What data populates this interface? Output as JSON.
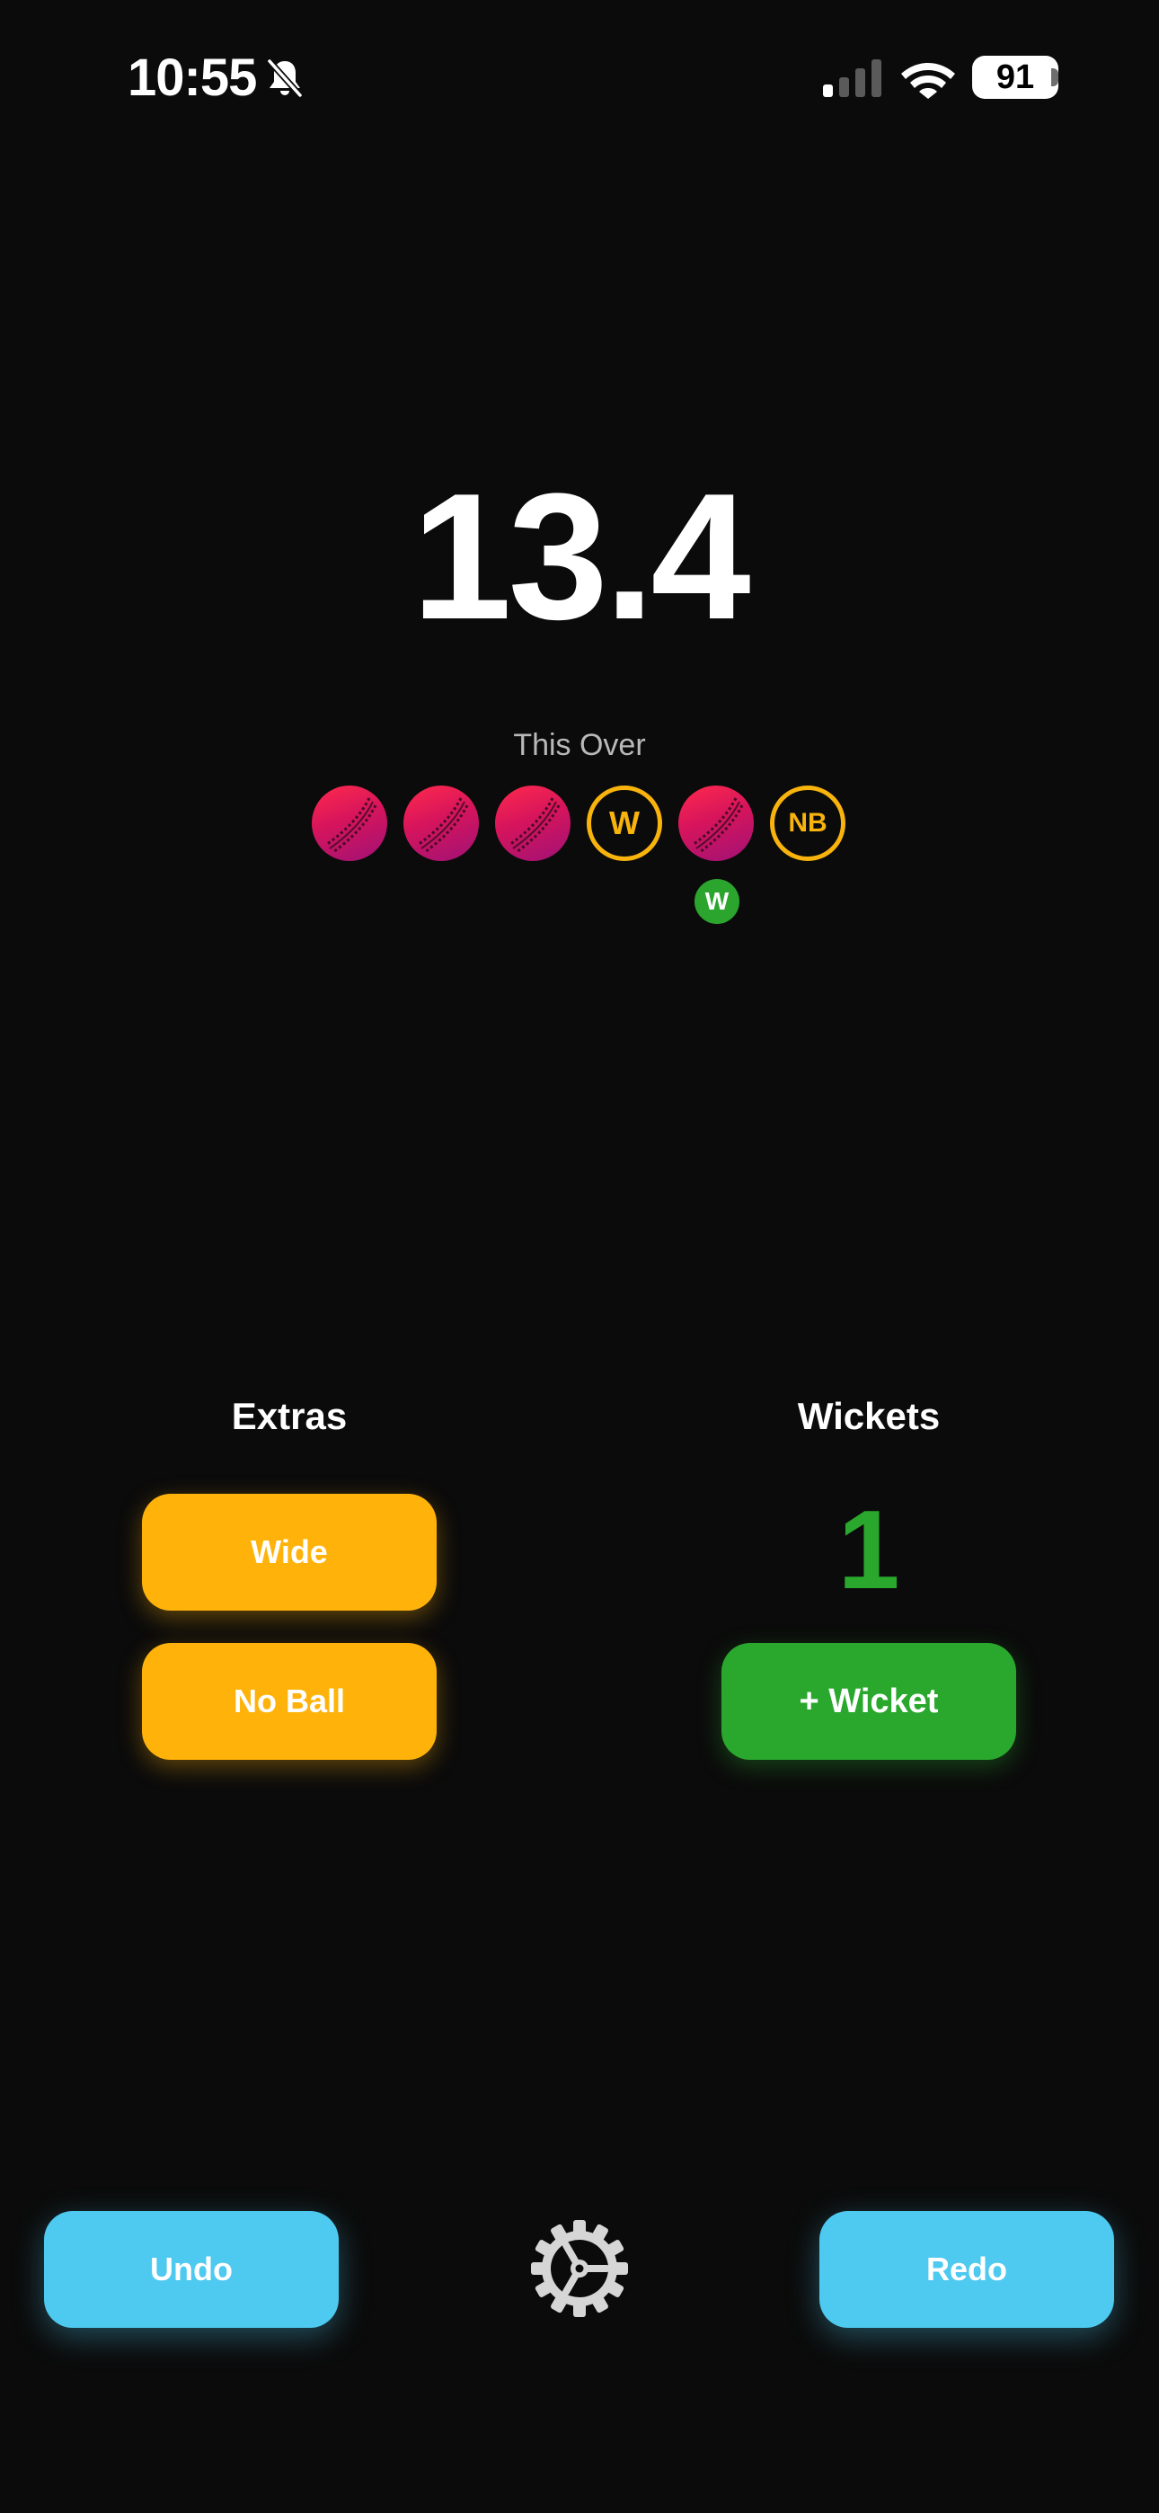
{
  "status_bar": {
    "time": "10:55",
    "battery": "91",
    "icons": [
      "bell-slash-icon",
      "cellular-signal-icon",
      "wifi-icon",
      "battery-icon"
    ]
  },
  "score": {
    "overs": "13.4",
    "this_over_label": "This Over"
  },
  "this_over": {
    "deliveries": [
      {
        "type": "ball",
        "icon": "cricket-ball-icon"
      },
      {
        "type": "ball",
        "icon": "cricket-ball-icon"
      },
      {
        "type": "ball",
        "icon": "cricket-ball-icon"
      },
      {
        "type": "extra",
        "label": "W"
      },
      {
        "type": "ball",
        "icon": "cricket-ball-icon",
        "wicket_badge": "W"
      },
      {
        "type": "extra",
        "label": "NB"
      }
    ]
  },
  "extras": {
    "title": "Extras",
    "wide_label": "Wide",
    "no_ball_label": "No Ball"
  },
  "wickets": {
    "title": "Wickets",
    "count": "1",
    "add_label": "+ Wicket"
  },
  "footer": {
    "undo_label": "Undo",
    "redo_label": "Redo",
    "settings_icon": "gear-icon"
  },
  "colors": {
    "background": "#0b0b0b",
    "extras_yellow": "#ffb30a",
    "wicket_green": "#2aa82e",
    "action_blue": "#4ec9f0",
    "ball_red": "#ff2a4c",
    "ball_purple": "#a01276"
  }
}
